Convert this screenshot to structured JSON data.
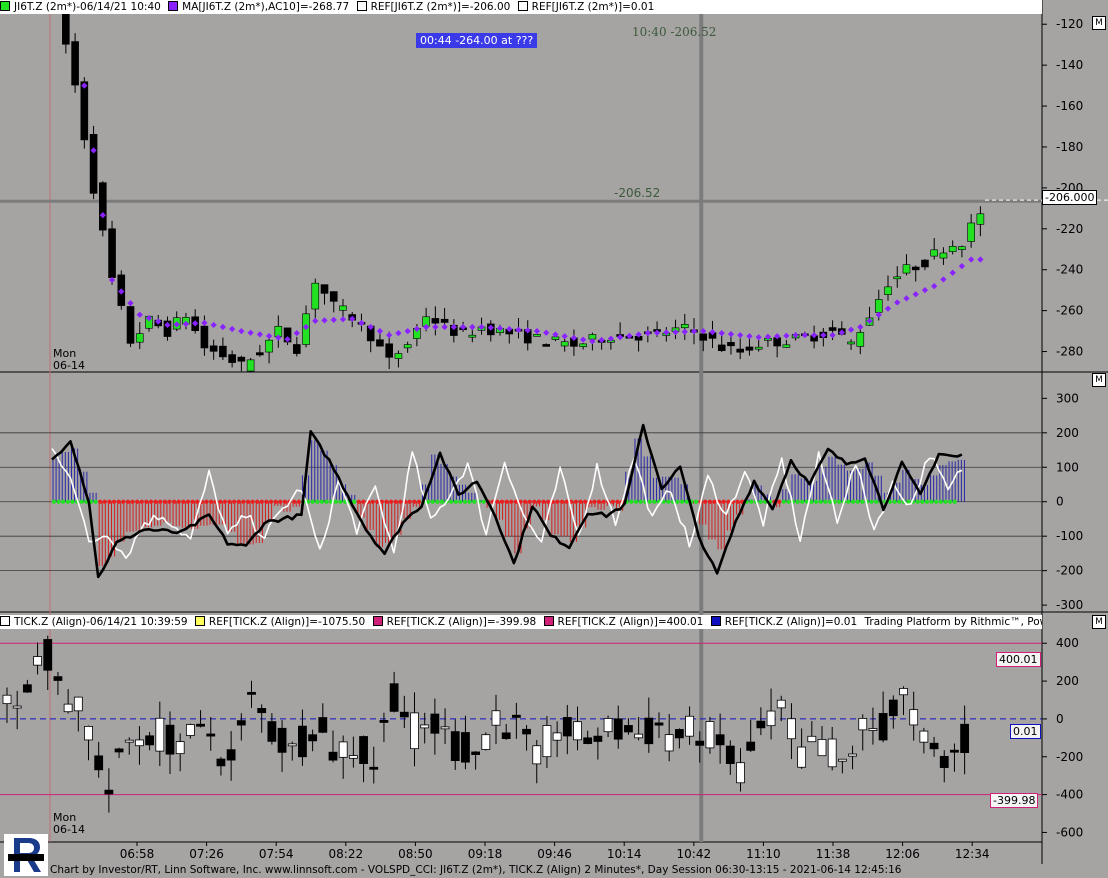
{
  "top_header": {
    "symbol": "JI6T.Z (2m*)-06/14/21 10:40",
    "ma": "MA[JI6T.Z (2m*),AC10]=-268.77",
    "ref1": "REF[JI6T.Z (2m*)]=-206.00",
    "ref2": "REF[JI6T.Z (2m*)]=0.01"
  },
  "tick_header": {
    "symbol": "TICK.Z (Align)-06/14/21 10:39:59",
    "ref1": "REF[TICK.Z (Align)]=-1075.50",
    "ref2": "REF[TICK.Z (Align)]=-399.98",
    "ref3": "REF[TICK.Z (Align)]=400.01",
    "ref4": "REF[TICK.Z (Align)]=0.01",
    "platform": "Trading Platform by Rithmic™, Powered by Omne™"
  },
  "m_button": "M",
  "info_box": "00:44  -264.00 at ???",
  "crosshair_top": "10:40  -206.52",
  "crosshair_mid": "-206.52",
  "price_ref_label": "-206.000",
  "day_label": [
    "Mon",
    "06-14"
  ],
  "tick_refs": {
    "upper": "400.01",
    "zero": "0.01",
    "lower": "-399.98"
  },
  "footer": "Chart by Investor/RT, Linn Software, Inc. www.linnsoft.com - VOLSPD_CCI: JI6T.Z (2m*), TICK.Z (Align) 2 Minutes*, Day Session 06:30-13:15 - 2021-06-14 12:45:16",
  "colors": {
    "background": "#a6a3a3",
    "up": "#22e022",
    "down": "#000000",
    "ma": "#8a22ff",
    "ref_pink": "#d0207a",
    "ref_blue": "#1010c0",
    "cci_pos": "#2a2aa8",
    "cci_neg": "#d22020"
  },
  "chart_data": [
    {
      "type": "candlestick",
      "name": "JI6T.Z (2m*)",
      "x_labels": [
        "06:58",
        "07:26",
        "07:54",
        "08:22",
        "08:50",
        "09:18",
        "09:46",
        "10:14",
        "10:42",
        "11:10",
        "11:38",
        "12:06",
        "12:34"
      ],
      "ylim": [
        -290,
        -115
      ],
      "yticks": [
        -120,
        -140,
        -160,
        -200,
        -220,
        -240,
        -260,
        -280
      ],
      "ytick_labels": [
        "-120",
        "-140",
        "-160",
        "-180",
        "-200",
        "-220",
        "-240",
        "-260",
        "-280"
      ],
      "ref_line": -206.0,
      "anchors": [
        [
          0,
          -110
        ],
        [
          2,
          -150
        ],
        [
          4,
          -200
        ],
        [
          6,
          -245
        ],
        [
          8,
          -275
        ],
        [
          10,
          -265
        ],
        [
          12,
          -270
        ],
        [
          14,
          -262
        ],
        [
          16,
          -278
        ],
        [
          18,
          -282
        ],
        [
          20,
          -287
        ],
        [
          22,
          -280
        ],
        [
          24,
          -270
        ],
        [
          26,
          -278
        ],
        [
          28,
          -245
        ],
        [
          30,
          -258
        ],
        [
          32,
          -263
        ],
        [
          34,
          -272
        ],
        [
          36,
          -285
        ],
        [
          38,
          -276
        ],
        [
          40,
          -262
        ],
        [
          42,
          -268
        ],
        [
          44,
          -272
        ],
        [
          46,
          -268
        ],
        [
          48,
          -270
        ],
        [
          52,
          -274
        ],
        [
          56,
          -277
        ],
        [
          60,
          -272
        ],
        [
          64,
          -272
        ],
        [
          68,
          -269
        ],
        [
          70,
          -272
        ],
        [
          72,
          -278
        ],
        [
          74,
          -280
        ],
        [
          76,
          -276
        ],
        [
          80,
          -274
        ],
        [
          84,
          -270
        ],
        [
          86,
          -276
        ],
        [
          88,
          -262
        ],
        [
          90,
          -246
        ],
        [
          92,
          -240
        ],
        [
          94,
          -236
        ],
        [
          96,
          -229
        ],
        [
          98,
          -226
        ],
        [
          100,
          -212
        ]
      ],
      "ma_anchors": [
        [
          3,
          -150
        ],
        [
          6,
          -245
        ],
        [
          9,
          -262
        ],
        [
          12,
          -267
        ],
        [
          16,
          -266
        ],
        [
          20,
          -270
        ],
        [
          25,
          -274
        ],
        [
          28,
          -265
        ],
        [
          32,
          -264
        ],
        [
          36,
          -272
        ],
        [
          40,
          -268
        ],
        [
          46,
          -268
        ],
        [
          52,
          -270
        ],
        [
          58,
          -275
        ],
        [
          64,
          -271
        ],
        [
          70,
          -270
        ],
        [
          76,
          -273
        ],
        [
          80,
          -272
        ],
        [
          84,
          -272
        ],
        [
          87,
          -268
        ],
        [
          91,
          -256
        ],
        [
          95,
          -248
        ],
        [
          99,
          -235
        ]
      ]
    },
    {
      "type": "line",
      "name": "VOLSPD_CCI",
      "ylim": [
        -320,
        330
      ],
      "yticks": [
        300,
        200,
        100,
        0,
        -100,
        -200,
        -300
      ],
      "hlines": [
        200,
        100,
        0,
        -100,
        -200
      ],
      "black_anchors": [
        [
          0,
          120
        ],
        [
          2,
          180
        ],
        [
          4,
          0
        ],
        [
          5,
          -220
        ],
        [
          7,
          -120
        ],
        [
          10,
          -80
        ],
        [
          14,
          -90
        ],
        [
          17,
          -40
        ],
        [
          19,
          -120
        ],
        [
          21,
          -130
        ],
        [
          23,
          -60
        ],
        [
          27,
          -40
        ],
        [
          28,
          200
        ],
        [
          30,
          120
        ],
        [
          32,
          20
        ],
        [
          34,
          -80
        ],
        [
          36,
          -150
        ],
        [
          38,
          -60
        ],
        [
          40,
          -10
        ],
        [
          42,
          140
        ],
        [
          44,
          20
        ],
        [
          46,
          60
        ],
        [
          48,
          -40
        ],
        [
          50,
          -180
        ],
        [
          52,
          -10
        ],
        [
          54,
          -100
        ],
        [
          56,
          -130
        ],
        [
          58,
          -30
        ],
        [
          60,
          -40
        ],
        [
          62,
          -10
        ],
        [
          64,
          220
        ],
        [
          66,
          40
        ],
        [
          68,
          100
        ],
        [
          70,
          -100
        ],
        [
          72,
          -210
        ],
        [
          74,
          -60
        ],
        [
          76,
          60
        ],
        [
          78,
          -20
        ],
        [
          80,
          120
        ],
        [
          82,
          50
        ],
        [
          84,
          150
        ],
        [
          86,
          110
        ],
        [
          88,
          130
        ],
        [
          90,
          -20
        ],
        [
          92,
          110
        ],
        [
          94,
          20
        ],
        [
          96,
          140
        ],
        [
          98,
          130
        ],
        [
          100,
          150
        ]
      ],
      "white_anchors": [
        [
          0,
          150
        ],
        [
          2,
          80
        ],
        [
          4,
          -120
        ],
        [
          6,
          -90
        ],
        [
          8,
          -160
        ],
        [
          10,
          -60
        ],
        [
          12,
          -40
        ],
        [
          15,
          -110
        ],
        [
          17,
          80
        ],
        [
          19,
          -100
        ],
        [
          21,
          -40
        ],
        [
          23,
          -100
        ],
        [
          25,
          -20
        ],
        [
          27,
          40
        ],
        [
          29,
          -150
        ],
        [
          31,
          60
        ],
        [
          33,
          -80
        ],
        [
          35,
          40
        ],
        [
          37,
          -150
        ],
        [
          39,
          140
        ],
        [
          41,
          -60
        ],
        [
          43,
          20
        ],
        [
          45,
          110
        ],
        [
          47,
          -90
        ],
        [
          49,
          120
        ],
        [
          51,
          -40
        ],
        [
          53,
          -120
        ],
        [
          55,
          90
        ],
        [
          57,
          -100
        ],
        [
          59,
          100
        ],
        [
          61,
          -60
        ],
        [
          63,
          130
        ],
        [
          65,
          -50
        ],
        [
          67,
          40
        ],
        [
          69,
          -130
        ],
        [
          71,
          70
        ],
        [
          73,
          -40
        ],
        [
          75,
          90
        ],
        [
          77,
          -60
        ],
        [
          79,
          120
        ],
        [
          81,
          -110
        ],
        [
          83,
          130
        ],
        [
          85,
          -50
        ],
        [
          87,
          110
        ],
        [
          89,
          -80
        ],
        [
          91,
          50
        ],
        [
          93,
          -10
        ],
        [
          95,
          140
        ],
        [
          97,
          30
        ],
        [
          99,
          120
        ]
      ],
      "histogram_anchors": [
        [
          0,
          120
        ],
        [
          2,
          150
        ],
        [
          4,
          20
        ],
        [
          5,
          -180
        ],
        [
          8,
          -90
        ],
        [
          12,
          -60
        ],
        [
          15,
          -70
        ],
        [
          18,
          -60
        ],
        [
          20,
          -120
        ],
        [
          22,
          -110
        ],
        [
          24,
          -20
        ],
        [
          26,
          -20
        ],
        [
          28,
          180
        ],
        [
          31,
          60
        ],
        [
          33,
          -40
        ],
        [
          35,
          -130
        ],
        [
          37,
          -90
        ],
        [
          39,
          -20
        ],
        [
          41,
          130
        ],
        [
          44,
          50
        ],
        [
          46,
          10
        ],
        [
          48,
          -60
        ],
        [
          50,
          -150
        ],
        [
          52,
          -20
        ],
        [
          54,
          -100
        ],
        [
          56,
          -120
        ],
        [
          58,
          -20
        ],
        [
          61,
          -20
        ],
        [
          63,
          180
        ],
        [
          65,
          70
        ],
        [
          68,
          60
        ],
        [
          70,
          -60
        ],
        [
          72,
          -140
        ],
        [
          74,
          -40
        ],
        [
          76,
          40
        ],
        [
          78,
          -10
        ],
        [
          80,
          80
        ],
        [
          82,
          60
        ],
        [
          84,
          130
        ],
        [
          86,
          90
        ],
        [
          88,
          110
        ],
        [
          90,
          30
        ],
        [
          92,
          90
        ],
        [
          94,
          40
        ],
        [
          96,
          110
        ],
        [
          98,
          120
        ],
        [
          100,
          110
        ]
      ]
    },
    {
      "type": "candlestick",
      "name": "TICK.Z (Align)",
      "ylim": [
        -640,
        470
      ],
      "yticks": [
        400,
        200,
        0,
        -200,
        -400,
        -600
      ],
      "ref_lines": [
        400.01,
        0.01,
        -399.98
      ],
      "anchors": [
        [
          0,
          80
        ],
        [
          2,
          240
        ],
        [
          4,
          350
        ],
        [
          6,
          120
        ],
        [
          8,
          -60
        ],
        [
          10,
          -380
        ],
        [
          12,
          -120
        ],
        [
          14,
          -60
        ],
        [
          16,
          -100
        ],
        [
          18,
          -120
        ],
        [
          20,
          -80
        ],
        [
          22,
          -250
        ],
        [
          24,
          90
        ],
        [
          26,
          -60
        ],
        [
          28,
          -180
        ],
        [
          30,
          -20
        ],
        [
          32,
          -160
        ],
        [
          34,
          -140
        ],
        [
          36,
          -240
        ],
        [
          38,
          140
        ],
        [
          40,
          -60
        ],
        [
          42,
          -40
        ],
        [
          44,
          -140
        ],
        [
          46,
          -180
        ],
        [
          48,
          30
        ],
        [
          50,
          -60
        ],
        [
          52,
          -240
        ],
        [
          54,
          -20
        ],
        [
          56,
          -110
        ],
        [
          58,
          -90
        ],
        [
          60,
          -60
        ],
        [
          62,
          -80
        ],
        [
          64,
          -40
        ],
        [
          66,
          -100
        ],
        [
          68,
          -60
        ],
        [
          70,
          -160
        ],
        [
          72,
          -280
        ],
        [
          74,
          -80
        ],
        [
          76,
          40
        ],
        [
          78,
          -200
        ],
        [
          80,
          -120
        ],
        [
          82,
          -240
        ],
        [
          84,
          -60
        ],
        [
          86,
          -40
        ],
        [
          88,
          120
        ],
        [
          90,
          -140
        ],
        [
          92,
          -260
        ],
        [
          94,
          -120
        ],
        [
          96,
          220
        ],
        [
          98,
          310
        ],
        [
          100,
          240
        ]
      ]
    }
  ]
}
